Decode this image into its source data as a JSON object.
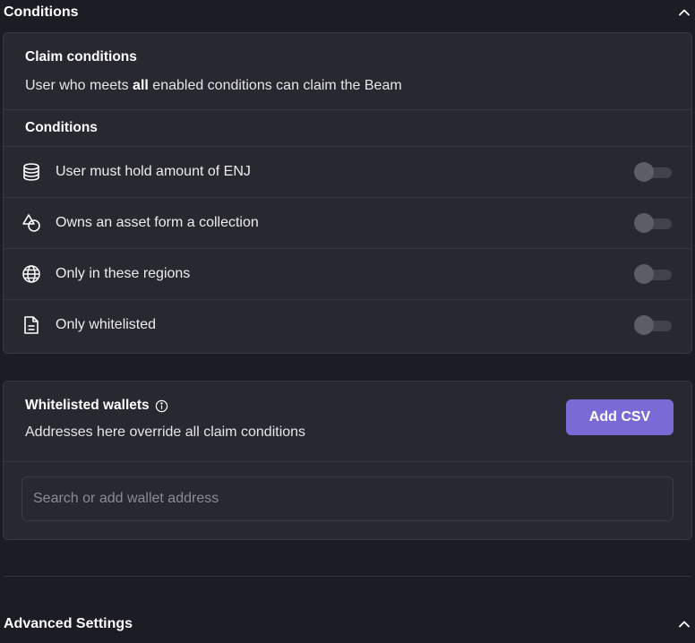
{
  "conditions_section": {
    "title": "Conditions"
  },
  "claim_card": {
    "title": "Claim conditions",
    "desc_prefix": "User who meets ",
    "desc_bold": "all",
    "desc_suffix": " enabled conditions can claim the Beam",
    "subtitle": "Conditions",
    "rows": [
      {
        "label": "User must hold amount of ENJ",
        "icon": "database-icon",
        "enabled": false
      },
      {
        "label": "Owns an asset form a collection",
        "icon": "shapes-icon",
        "enabled": false
      },
      {
        "label": "Only in these regions",
        "icon": "globe-icon",
        "enabled": false
      },
      {
        "label": "Only whitelisted",
        "icon": "document-icon",
        "enabled": false
      }
    ]
  },
  "whitelist_card": {
    "title": "Whitelisted wallets",
    "desc": "Addresses here override all claim conditions",
    "add_button": "Add CSV",
    "search_placeholder": "Search or add wallet address",
    "search_value": ""
  },
  "advanced_section": {
    "title": "Advanced Settings"
  },
  "colors": {
    "background": "#1c1d24",
    "card": "#272830",
    "accent": "#7a6ad6"
  }
}
